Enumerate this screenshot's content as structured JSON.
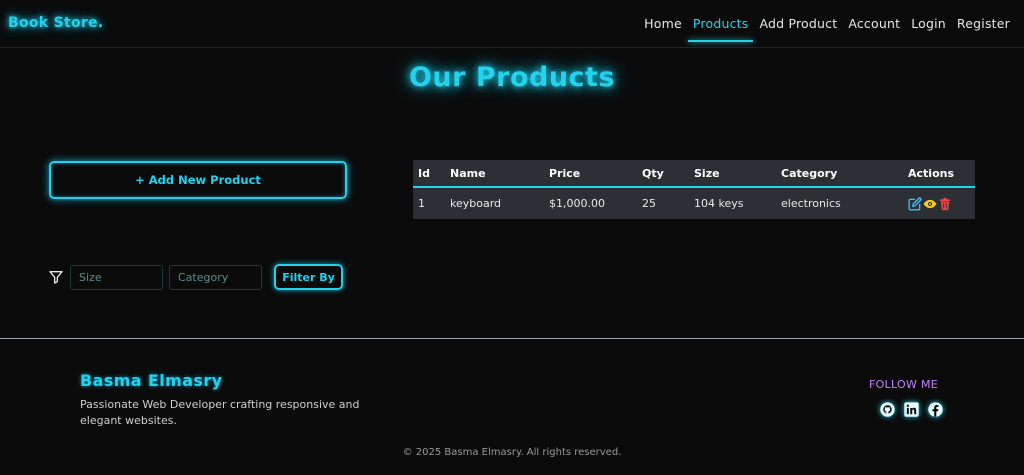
{
  "brand": "Book Store.",
  "nav": {
    "home": "Home",
    "products": "Products",
    "add_product": "Add Product",
    "account": "Account",
    "login": "Login",
    "register": "Register"
  },
  "page_title": "Our Products",
  "add_button": "+ Add New Product",
  "filter": {
    "size_placeholder": "Size",
    "category_placeholder": "Category",
    "button": "Filter By"
  },
  "table": {
    "headers": [
      "Id",
      "Name",
      "Price",
      "Qty",
      "Size",
      "Category",
      "Actions"
    ],
    "rows": [
      {
        "id": "1",
        "name": "keyboard",
        "price": "$1,000.00",
        "qty": "25",
        "size": "104 keys",
        "category": "electronics"
      }
    ]
  },
  "footer": {
    "name": "Basma Elmasry",
    "description": "Passionate Web Developer crafting responsive and elegant websites.",
    "follow": "FOLLOW ME",
    "copyright": "© 2025 Basma Elmasry. All rights reserved."
  },
  "icons": {
    "edit": "edit-icon",
    "view": "eye-icon",
    "delete": "trash-icon",
    "filter": "funnel-icon",
    "github": "github-icon",
    "linkedin": "linkedin-icon",
    "facebook": "facebook-icon"
  },
  "colors": {
    "accent": "#22d3ee",
    "follow": "#c084fc",
    "edit": "#38bdf8",
    "view": "#facc15",
    "delete": "#ef4444"
  }
}
